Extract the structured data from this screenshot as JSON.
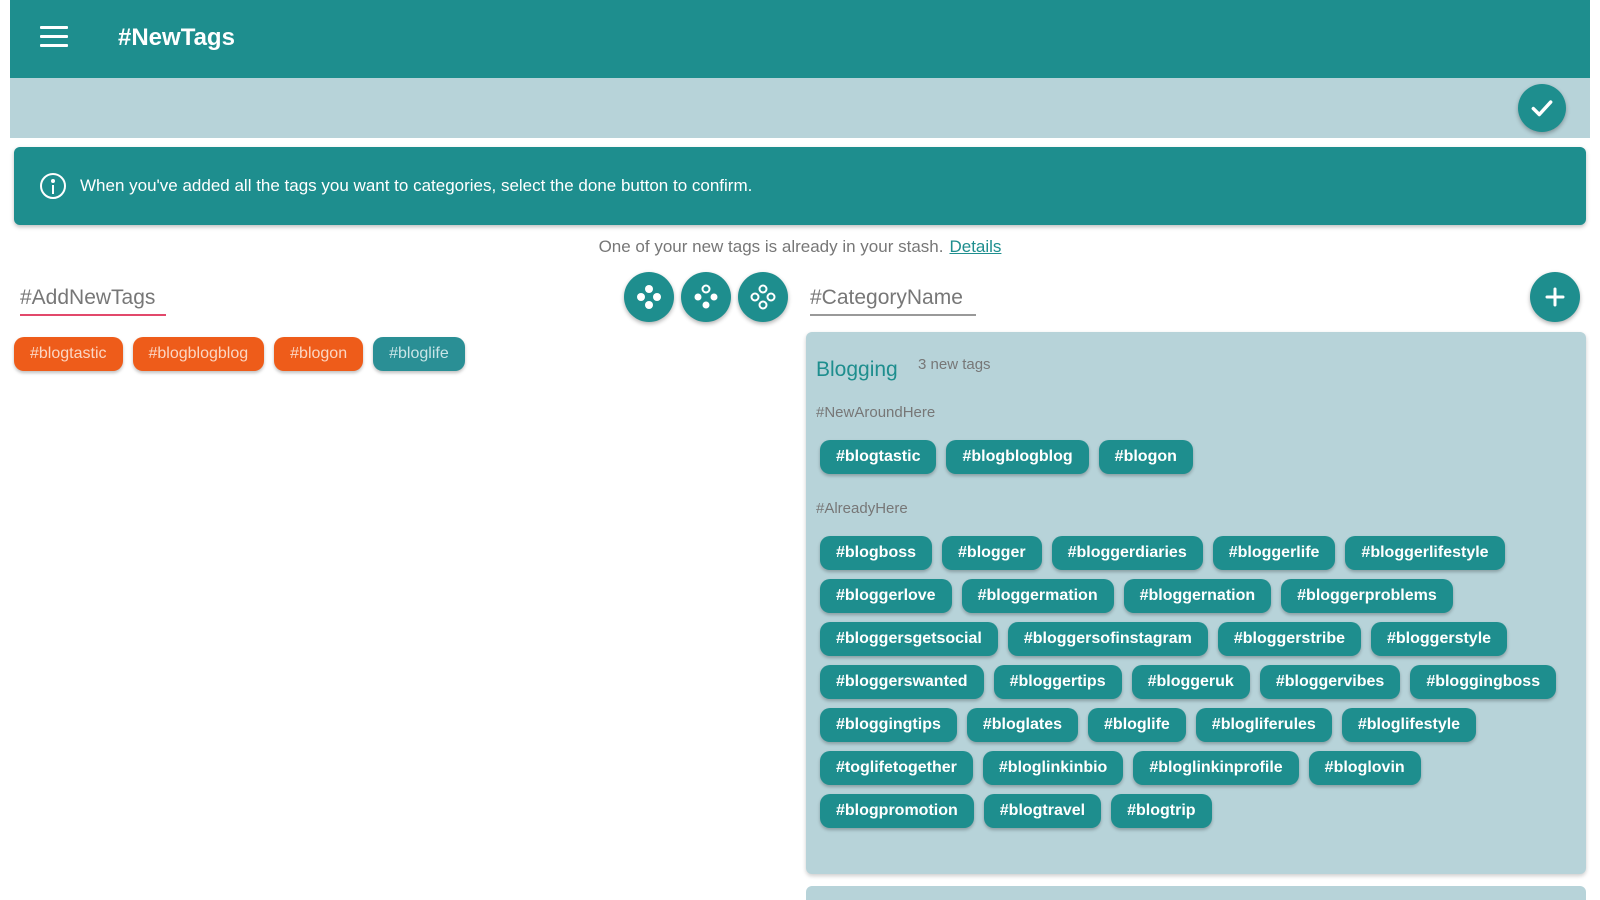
{
  "appbar": {
    "title": "#NewTags",
    "icons": {
      "menu": "menu-icon"
    }
  },
  "subbar": {
    "done_icon": "check-icon"
  },
  "banner": {
    "text": "When you've added all the tags you want to categories, select the done button to confirm.",
    "icon": "info-icon"
  },
  "notice": {
    "text": "One of your new tags is already in your stash.",
    "link": "Details"
  },
  "left": {
    "input_placeholder": "#AddNewTags",
    "tags": [
      {
        "label": "#blogtastic",
        "style": "orange"
      },
      {
        "label": "#blogblogblog",
        "style": "orange"
      },
      {
        "label": "#blogon",
        "style": "orange"
      },
      {
        "label": "#bloglife",
        "style": "teal"
      }
    ]
  },
  "right": {
    "input_placeholder": "#CategoryName",
    "category": {
      "name": "Blogging",
      "count_text": "3 new tags",
      "new_label": "#NewAroundHere",
      "new_tags": [
        "#blogtastic",
        "#blogblogblog",
        "#blogon"
      ],
      "existing_label": "#AlreadyHere",
      "existing_tags": [
        "#blogboss",
        "#blogger",
        "#bloggerdiaries",
        "#bloggerlife",
        "#bloggerlifestyle",
        "#bloggerlove",
        "#bloggermation",
        "#bloggernation",
        "#bloggerproblems",
        "#bloggersgetsocial",
        "#bloggersofinstagram",
        "#bloggerstribe",
        "#bloggerstyle",
        "#bloggerswanted",
        "#bloggertips",
        "#bloggeruk",
        "#bloggervibes",
        "#bloggingboss",
        "#bloggingtips",
        "#bloglates",
        "#bloglife",
        "#blogliferules",
        "#bloglifestyle",
        "#toglifetogether",
        "#bloglinkinbio",
        "#bloglinkinprofile",
        "#bloglovin",
        "#blogpromotion",
        "#blogtravel",
        "#blogtrip"
      ]
    }
  },
  "colors": {
    "primary": "#1e8e8e",
    "subbar": "#b7d3d9",
    "accent_orange": "#ee5c1a",
    "underline_pink": "#e2486b"
  }
}
